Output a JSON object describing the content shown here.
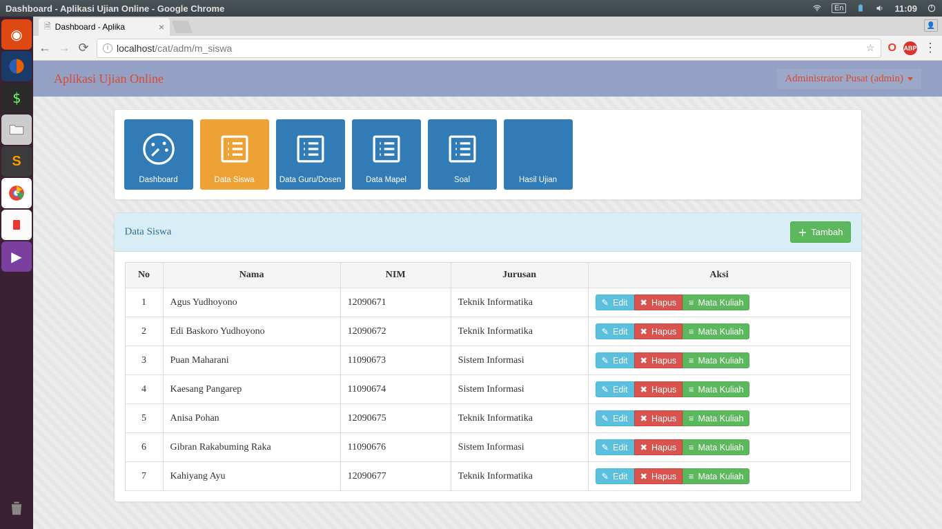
{
  "os": {
    "window_title": "Dashboard - Aplikasi Ujian Online - Google Chrome",
    "lang": "En",
    "time": "11:09"
  },
  "browser": {
    "tab_title": "Dashboard - Aplika",
    "url_host": "localhost",
    "url_path": "/cat/adm/m_siswa"
  },
  "app": {
    "brand": "Aplikasi Ujian Online",
    "user_label": "Administrator Pusat (admin)"
  },
  "tiles": [
    {
      "label": "Dashboard",
      "color": "blue",
      "icon": "gauge"
    },
    {
      "label": "Data Siswa",
      "color": "orange",
      "icon": "list"
    },
    {
      "label": "Data Guru/Dosen",
      "color": "blue",
      "icon": "list"
    },
    {
      "label": "Data Mapel",
      "color": "blue",
      "icon": "list"
    },
    {
      "label": "Soal",
      "color": "blue",
      "icon": "list"
    },
    {
      "label": "Hasil Ujian",
      "color": "blue",
      "icon": "file"
    }
  ],
  "panel": {
    "title": "Data Siswa",
    "add_label": "Tambah",
    "columns": [
      "No",
      "Nama",
      "NIM",
      "Jurusan",
      "Aksi"
    ],
    "actions": {
      "edit": "Edit",
      "delete": "Hapus",
      "courses": "Mata Kuliah"
    },
    "rows": [
      {
        "no": "1",
        "nama": "Agus Yudhoyono",
        "nim": "12090671",
        "jurusan": "Teknik Informatika"
      },
      {
        "no": "2",
        "nama": "Edi Baskoro Yudhoyono",
        "nim": "12090672",
        "jurusan": "Teknik Informatika"
      },
      {
        "no": "3",
        "nama": "Puan Maharani",
        "nim": "11090673",
        "jurusan": "Sistem Informasi"
      },
      {
        "no": "4",
        "nama": "Kaesang Pangarep",
        "nim": "11090674",
        "jurusan": "Sistem Informasi"
      },
      {
        "no": "5",
        "nama": "Anisa Pohan",
        "nim": "12090675",
        "jurusan": "Teknik Informatika"
      },
      {
        "no": "6",
        "nama": "Gibran Rakabuming Raka",
        "nim": "11090676",
        "jurusan": "Sistem Informasi"
      },
      {
        "no": "7",
        "nama": "Kahiyang Ayu",
        "nim": "12090677",
        "jurusan": "Teknik Informatika"
      }
    ]
  }
}
